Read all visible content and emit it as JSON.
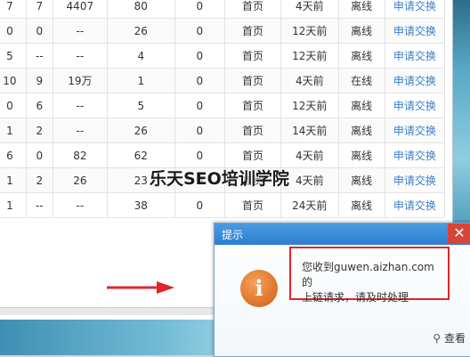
{
  "table": {
    "rows": [
      [
        "7",
        "7",
        "4407",
        "80",
        "0",
        "首页",
        "4天前",
        "离线",
        "申请交换"
      ],
      [
        "0",
        "0",
        "--",
        "26",
        "0",
        "首页",
        "12天前",
        "离线",
        "申请交换"
      ],
      [
        "5",
        "--",
        "--",
        "4",
        "0",
        "首页",
        "12天前",
        "离线",
        "申请交换"
      ],
      [
        "10",
        "9",
        "19万",
        "1",
        "0",
        "首页",
        "4天前",
        "在线",
        "申请交换"
      ],
      [
        "0",
        "6",
        "--",
        "5",
        "0",
        "首页",
        "12天前",
        "离线",
        "申请交换"
      ],
      [
        "1",
        "2",
        "--",
        "26",
        "0",
        "首页",
        "14天前",
        "离线",
        "申请交换"
      ],
      [
        "6",
        "0",
        "82",
        "62",
        "0",
        "首页",
        "4天前",
        "离线",
        "申请交换"
      ],
      [
        "1",
        "2",
        "26",
        "23",
        "0",
        "首页",
        "4天前",
        "离线",
        "申请交换"
      ],
      [
        "1",
        "--",
        "--",
        "38",
        "0",
        "首页",
        "24天前",
        "离线",
        "申请交换"
      ]
    ]
  },
  "watermark": "乐天SEO培训学院",
  "popup": {
    "title": "提示",
    "close_glyph": "✕",
    "icon_glyph": "i",
    "message_line1": "您收到guwen.aizhan.com的",
    "message_line2": "上链请求，请及时处理",
    "view_label": "查看",
    "search_glyph": "⚲"
  },
  "colors": {
    "link": "#3a7fc8",
    "titlebar": "#2c7fd0",
    "highlight_border": "#e0262a",
    "arrow": "#e0262a"
  }
}
